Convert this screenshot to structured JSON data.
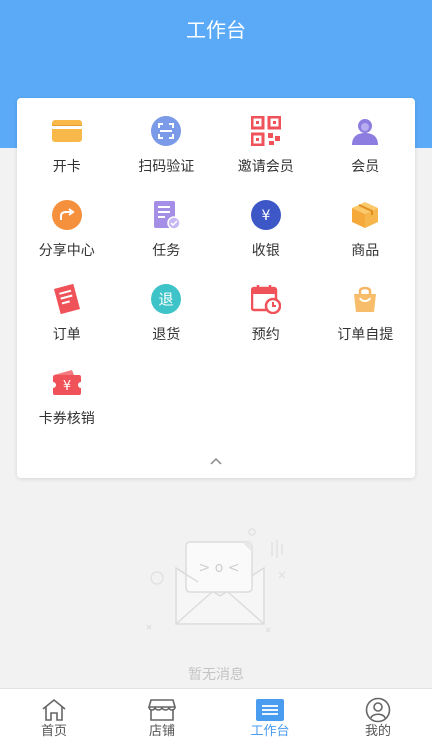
{
  "header": {
    "title": "工作台"
  },
  "grid": {
    "items": [
      {
        "label": "开卡",
        "icon": "card-icon"
      },
      {
        "label": "扫码验证",
        "icon": "scan-icon"
      },
      {
        "label": "邀请会员",
        "icon": "qrcode-icon"
      },
      {
        "label": "会员",
        "icon": "member-icon"
      },
      {
        "label": "分享中心",
        "icon": "share-icon"
      },
      {
        "label": "任务",
        "icon": "task-icon"
      },
      {
        "label": "收银",
        "icon": "cashier-icon"
      },
      {
        "label": "商品",
        "icon": "product-box-icon"
      },
      {
        "label": "订单",
        "icon": "order-receipt-icon"
      },
      {
        "label": "退货",
        "icon": "return-icon"
      },
      {
        "label": "预约",
        "icon": "calendar-icon"
      },
      {
        "label": "订单自提",
        "icon": "pickup-bag-icon"
      },
      {
        "label": "卡券核销",
        "icon": "coupon-icon"
      }
    ]
  },
  "empty": {
    "text": "暂无消息"
  },
  "tabbar": {
    "items": [
      {
        "label": "首页",
        "icon": "home-icon"
      },
      {
        "label": "店铺",
        "icon": "store-icon"
      },
      {
        "label": "工作台",
        "icon": "workbench-icon",
        "active": true
      },
      {
        "label": "我的",
        "icon": "profile-icon"
      }
    ]
  },
  "colors": {
    "header": "#5aaaf8",
    "accent": "#4a9cf0",
    "background": "#f2f2f2"
  }
}
